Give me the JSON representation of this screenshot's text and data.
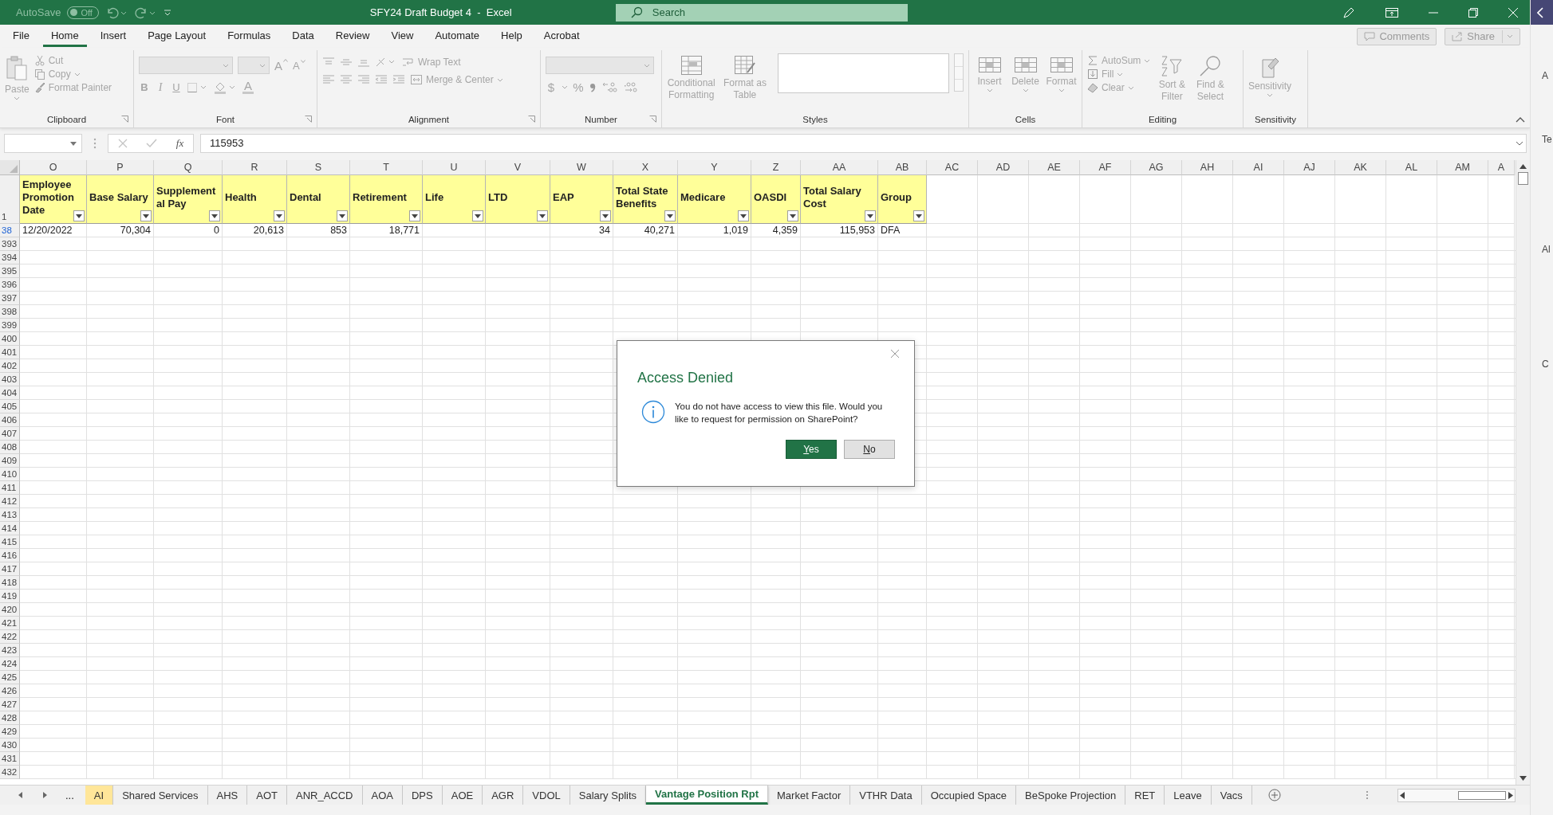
{
  "title_bar": {
    "autosave_label": "AutoSave",
    "autosave_state": "Off",
    "autosave_on": false,
    "title": "SFY24 Draft Budget 4  -  Excel",
    "search_placeholder": "Search"
  },
  "menu_tabs": [
    {
      "label": "File",
      "selected": false
    },
    {
      "label": "Home",
      "selected": true
    },
    {
      "label": "Insert",
      "selected": false
    },
    {
      "label": "Page Layout",
      "selected": false
    },
    {
      "label": "Formulas",
      "selected": false
    },
    {
      "label": "Data",
      "selected": false
    },
    {
      "label": "Review",
      "selected": false
    },
    {
      "label": "View",
      "selected": false
    },
    {
      "label": "Automate",
      "selected": false
    },
    {
      "label": "Help",
      "selected": false
    },
    {
      "label": "Acrobat",
      "selected": false
    }
  ],
  "comments_button": "Comments",
  "share_button": "Share",
  "ribbon": {
    "disabled": true,
    "groups": [
      {
        "label": "Clipboard",
        "items": [
          "Paste",
          "Cut",
          "Copy",
          "Format Painter"
        ]
      },
      {
        "label": "Font",
        "items": [
          "A",
          "A",
          "B",
          "I",
          "U",
          "A"
        ]
      },
      {
        "label": "Alignment",
        "items": [
          "Wrap Text",
          "Merge & Center"
        ]
      },
      {
        "label": "Number",
        "items": [
          "$",
          "%"
        ]
      },
      {
        "label": "Styles",
        "items": [
          "Conditional Formatting",
          "Format as Table"
        ]
      },
      {
        "label": "Cells",
        "items": [
          "Insert",
          "Delete",
          "Format"
        ]
      },
      {
        "label": "Editing",
        "items": [
          "AutoSum",
          "Fill",
          "Clear",
          "Sort & Filter",
          "Find & Select"
        ]
      },
      {
        "label": "Sensitivity",
        "items": [
          "Sensitivity"
        ]
      }
    ]
  },
  "formula_bar": {
    "function_label": "fx",
    "value": "115953"
  },
  "column_headers": [
    "O",
    "P",
    "Q",
    "R",
    "S",
    "T",
    "U",
    "V",
    "W",
    "X",
    "Y",
    "Z",
    "AA",
    "AB",
    "AC",
    "AD",
    "AE",
    "AF",
    "AG",
    "AH",
    "AI",
    "AJ",
    "AK",
    "AL",
    "AM",
    "A"
  ],
  "header_row": {
    "number": "1",
    "cells": [
      {
        "lines": [
          "Employee",
          "Promotion",
          "Date"
        ]
      },
      {
        "lines": [
          "Base Salary"
        ]
      },
      {
        "lines": [
          "Supplement",
          "al Pay"
        ]
      },
      {
        "lines": [
          "Health"
        ]
      },
      {
        "lines": [
          "Dental"
        ]
      },
      {
        "lines": [
          "Retirement"
        ]
      },
      {
        "lines": [
          "Life"
        ]
      },
      {
        "lines": [
          "LTD"
        ]
      },
      {
        "lines": [
          "EAP"
        ]
      },
      {
        "lines": [
          "Total State",
          "Benefits"
        ]
      },
      {
        "lines": [
          "Medicare"
        ]
      },
      {
        "lines": [
          "OASDI"
        ]
      },
      {
        "lines": [
          "Total Salary",
          "Cost"
        ]
      },
      {
        "lines": [
          "Group"
        ]
      }
    ]
  },
  "data_row": {
    "number": "38",
    "filtered": true,
    "cells": [
      {
        "value": "12/20/2022",
        "kind": "text"
      },
      {
        "value": "70,304",
        "kind": "number"
      },
      {
        "value": "0",
        "kind": "number"
      },
      {
        "value": "20,613",
        "kind": "number"
      },
      {
        "value": "853",
        "kind": "number"
      },
      {
        "value": "18,771",
        "kind": "number"
      },
      {
        "kind": "blank"
      },
      {
        "kind": "blank"
      },
      {
        "value": "34",
        "kind": "number"
      },
      {
        "value": "40,271",
        "kind": "number"
      },
      {
        "value": "1,019",
        "kind": "number"
      },
      {
        "value": "4,359",
        "kind": "number"
      },
      {
        "value": "115,953",
        "kind": "number"
      },
      {
        "value": "DFA",
        "kind": "text"
      }
    ]
  },
  "empty_rows": [
    "393",
    "394",
    "395",
    "396",
    "397",
    "398",
    "399",
    "400",
    "401",
    "402",
    "403",
    "404",
    "405",
    "406",
    "407",
    "408",
    "409",
    "410",
    "411",
    "412",
    "413",
    "414",
    "415",
    "416",
    "417",
    "418",
    "419",
    "420",
    "421",
    "422",
    "423",
    "424",
    "425",
    "426",
    "427",
    "428",
    "429",
    "430",
    "431",
    "432"
  ],
  "sheet_tabs": {
    "more": "...",
    "tabs": [
      {
        "label": "AI",
        "selected": false,
        "color": "#ffe699"
      },
      {
        "label": "Shared Services",
        "selected": false
      },
      {
        "label": "AHS",
        "selected": false
      },
      {
        "label": "AOT",
        "selected": false
      },
      {
        "label": "ANR_ACCD",
        "selected": false
      },
      {
        "label": "AOA",
        "selected": false
      },
      {
        "label": "DPS",
        "selected": false
      },
      {
        "label": "AOE",
        "selected": false
      },
      {
        "label": "AGR",
        "selected": false
      },
      {
        "label": "VDOL",
        "selected": false
      },
      {
        "label": "Salary Splits",
        "selected": false
      },
      {
        "label": "Vantage Position Rpt",
        "selected": true
      },
      {
        "label": "Market Factor",
        "selected": false
      },
      {
        "label": "VTHR Data",
        "selected": false
      },
      {
        "label": "Occupied Space",
        "selected": false
      },
      {
        "label": "BeSpoke Projection",
        "selected": false
      },
      {
        "label": "RET",
        "selected": false
      },
      {
        "label": "Leave",
        "selected": false
      },
      {
        "label": "Vacs",
        "selected": false
      }
    ]
  },
  "side_panel": {
    "fragments": [
      "A",
      "Te",
      "Al",
      "C"
    ]
  },
  "dialog": {
    "title": "Access Denied",
    "message": "You do not have access to view this file. Would you like to request for permission on SharePoint?",
    "buttons": [
      {
        "label": "Yes",
        "primary": true
      },
      {
        "label": "No",
        "primary": false
      }
    ]
  }
}
